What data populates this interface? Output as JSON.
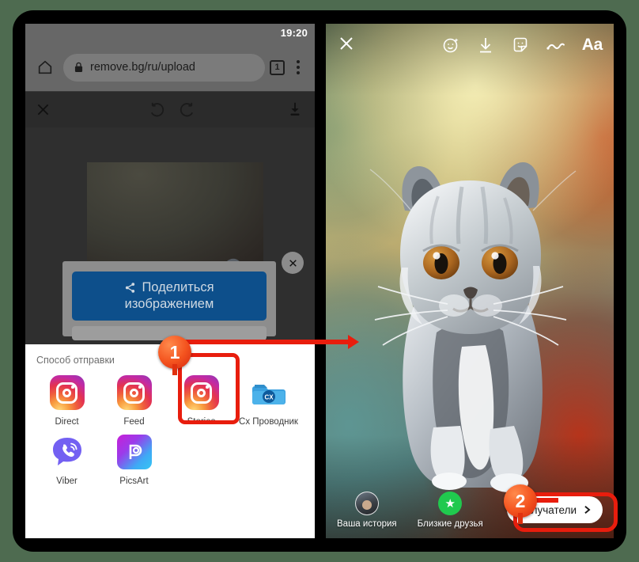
{
  "colors": {
    "accent_red": "#e81d0d",
    "badge_orange": "#f4541f",
    "instagram_pink": "#c32aa3",
    "rbg_blue": "#0d4f8b",
    "close_friends_green": "#20c94e",
    "page_background": "#4e6b50"
  },
  "left_phone": {
    "status_bar": {
      "clock": "19:20"
    },
    "browser": {
      "home_icon": "home-icon",
      "lock_icon": "lock-icon",
      "url": "remove.bg/ru/upload",
      "tab_count": "1",
      "menu_icon": "kebab-menu-icon"
    },
    "editor_toolbar": {
      "close_icon": "close-icon",
      "undo_icon": "undo-icon",
      "redo_icon": "redo-icon",
      "download_icon": "download-icon"
    },
    "share_card": {
      "share_icon": "share-nodes-icon",
      "button_line1": "Поделиться",
      "button_line2": "изображением",
      "close_icon": "close-circle-icon"
    },
    "share_sheet": {
      "title": "Способ отправки",
      "rows": [
        [
          {
            "label": "Direct",
            "icon": "instagram-icon"
          },
          {
            "label": "Feed",
            "icon": "instagram-icon"
          },
          {
            "label": "Stories",
            "icon": "instagram-icon",
            "highlighted": true
          },
          {
            "label": "Cx Проводник",
            "icon": "cx-explorer-folder-icon"
          }
        ],
        [
          {
            "label": "Viber",
            "icon": "viber-icon"
          },
          {
            "label": "PicsArt",
            "icon": "picsart-icon"
          }
        ]
      ]
    }
  },
  "right_phone": {
    "top_bar": {
      "close_icon": "close-icon",
      "icons": [
        "face-sparkle-effects-icon",
        "download-icon",
        "sticker-icon",
        "draw-squiggle-icon"
      ],
      "text_tool_label": "Aa"
    },
    "canvas": {
      "subject": "grey-white-kitten-cutout",
      "background": "blurred-gradient-green-yellow-orange-teal-red"
    },
    "bottom_bar": {
      "destinations": [
        {
          "label": "Ваша история",
          "icon": "avatar"
        },
        {
          "label": "Близкие друзья",
          "icon": "close-friends-star-icon"
        }
      ],
      "recipients_button": {
        "label": "Получатели",
        "chevron_icon": "chevron-right-icon"
      }
    }
  },
  "annotations": {
    "steps": [
      {
        "number": "1",
        "target": "Stories"
      },
      {
        "number": "2",
        "target": "Получатели"
      }
    ]
  }
}
